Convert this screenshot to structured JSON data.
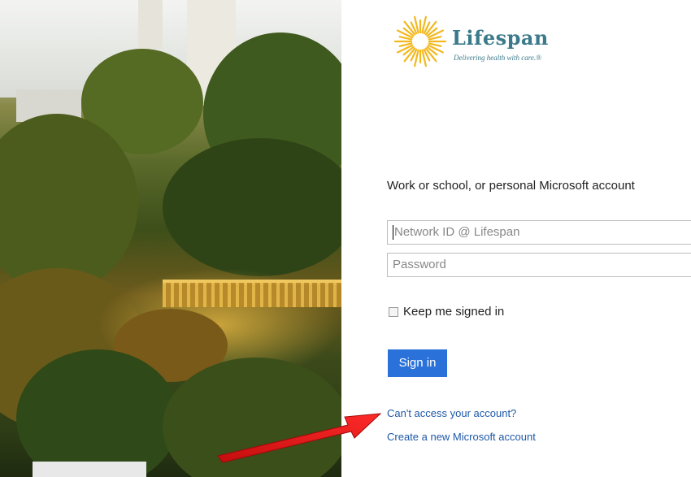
{
  "logo": {
    "brand": "Lifespan",
    "tagline": "Delivering health with care.®",
    "icon": "sun-logo-icon",
    "color": "#3b7a8a",
    "sun_color": "#f2b81e"
  },
  "form": {
    "heading": "Work or school, or personal Microsoft account",
    "username_placeholder": "Network ID @ Lifespan",
    "password_placeholder": "Password",
    "keep_signed_in_label": "Keep me signed in",
    "keep_signed_in_checked": false,
    "sign_in_label": "Sign in",
    "sign_in_color": "#2a72d9"
  },
  "links": {
    "cant_access": "Can't access your account?",
    "create_account": "Create a new Microsoft account",
    "link_color": "#1f58a8"
  },
  "annotation": {
    "arrow_icon": "red-arrow-icon",
    "arrow_color": "#e01818"
  }
}
